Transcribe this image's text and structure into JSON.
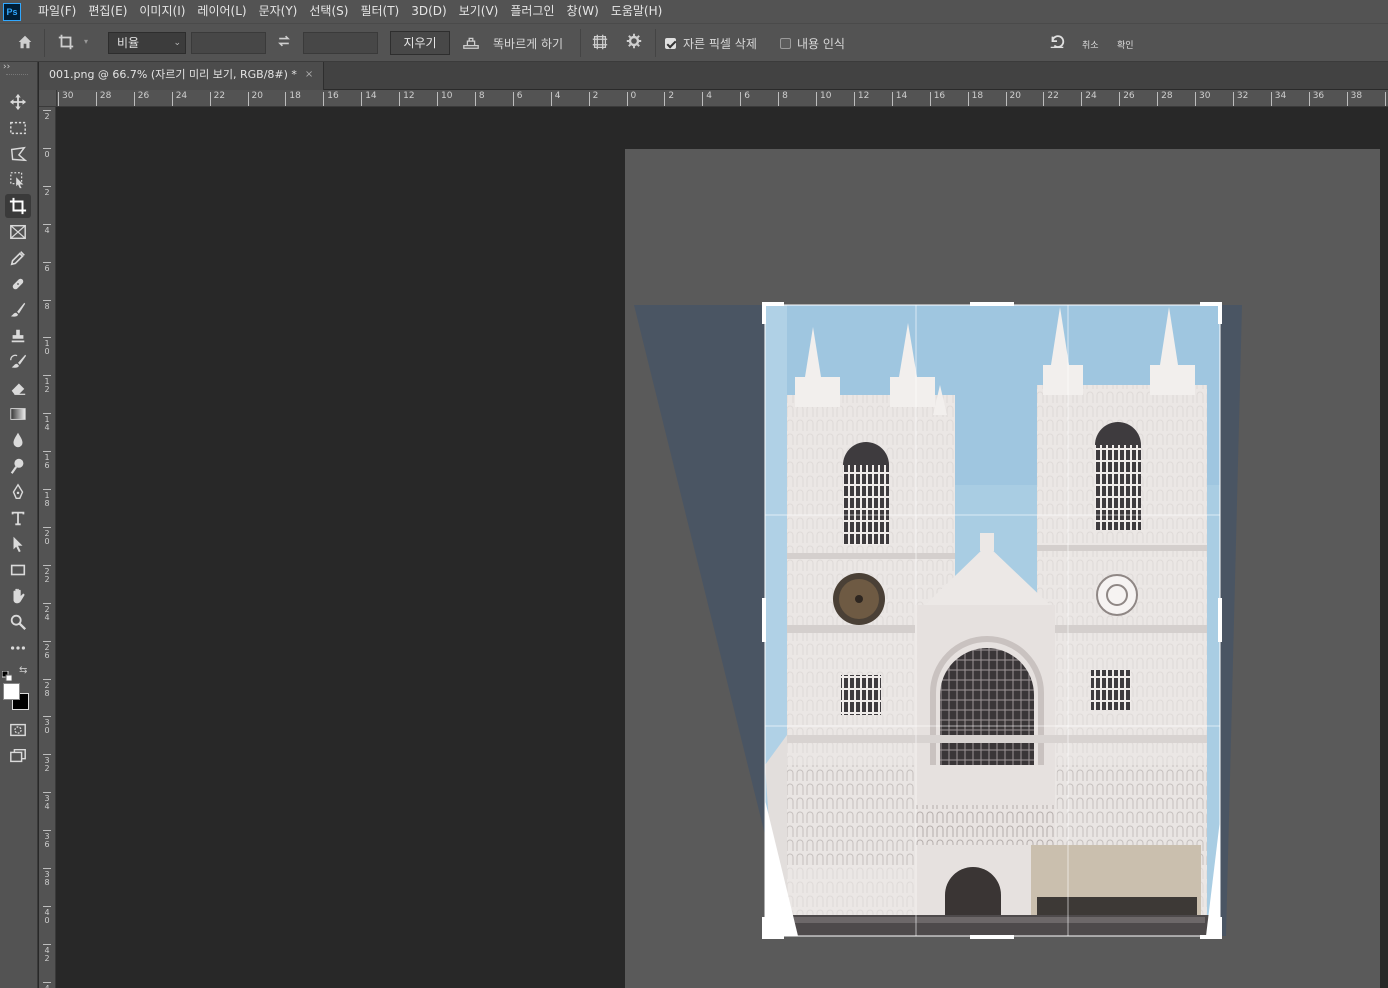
{
  "menubar": {
    "logo": "Ps",
    "items": [
      "파일(F)",
      "편집(E)",
      "이미지(I)",
      "레이어(L)",
      "문자(Y)",
      "선택(S)",
      "필터(T)",
      "3D(D)",
      "보기(V)",
      "플러그인",
      "창(W)",
      "도움말(H)"
    ]
  },
  "options": {
    "ratio_select": "비율",
    "width_value": "",
    "height_value": "",
    "clear_button": "지우기",
    "straighten_label": "똑바르게 하기",
    "delete_cropped_pixels_label": "자른 픽셀 삭제",
    "delete_cropped_pixels_checked": true,
    "content_aware_label": "내용 인식",
    "content_aware_checked": false,
    "cancel_label": "취소",
    "confirm_label": "확인"
  },
  "document": {
    "tab_title": "001.png @ 66.7% (자르기 미리 보기, RGB/8#) *",
    "close_symbol": "×"
  },
  "rulers": {
    "horizontal": [
      "30",
      "28",
      "26",
      "24",
      "22",
      "20",
      "18",
      "16",
      "14",
      "12",
      "10",
      "8",
      "6",
      "4",
      "2",
      "0",
      "2",
      "4",
      "6",
      "8",
      "10",
      "12",
      "14",
      "16",
      "18",
      "20",
      "22",
      "24",
      "26",
      "28",
      "30",
      "32",
      "34",
      "36",
      "38",
      "4"
    ],
    "vertical": [
      "2",
      "0",
      "2",
      "4",
      "6",
      "8",
      "10",
      "12",
      "14",
      "16",
      "18",
      "20",
      "22",
      "24",
      "26",
      "28",
      "30",
      "32",
      "34",
      "36",
      "38",
      "40",
      "42",
      "4"
    ]
  },
  "tools": [
    {
      "name": "move-tool",
      "icon": "move-icon"
    },
    {
      "name": "marquee-tool",
      "icon": "marquee-icon"
    },
    {
      "name": "lasso-tool",
      "icon": "lasso-icon"
    },
    {
      "name": "object-select-tool",
      "icon": "object-select-icon"
    },
    {
      "name": "crop-tool",
      "icon": "crop-icon",
      "active": true
    },
    {
      "name": "frame-tool",
      "icon": "frame-icon"
    },
    {
      "name": "eyedropper-tool",
      "icon": "eyedropper-icon"
    },
    {
      "name": "healing-brush-tool",
      "icon": "bandage-icon"
    },
    {
      "name": "brush-tool",
      "icon": "brush-icon"
    },
    {
      "name": "stamp-tool",
      "icon": "stamp-icon"
    },
    {
      "name": "history-brush-tool",
      "icon": "history-brush-icon"
    },
    {
      "name": "eraser-tool",
      "icon": "eraser-icon"
    },
    {
      "name": "gradient-tool",
      "icon": "gradient-icon"
    },
    {
      "name": "blur-tool",
      "icon": "drop-icon"
    },
    {
      "name": "dodge-tool",
      "icon": "dodge-icon"
    },
    {
      "name": "pen-tool",
      "icon": "pen-icon"
    },
    {
      "name": "type-tool",
      "icon": "type-icon"
    },
    {
      "name": "path-select-tool",
      "icon": "arrow-icon"
    },
    {
      "name": "rectangle-tool",
      "icon": "rectangle-icon"
    },
    {
      "name": "hand-tool",
      "icon": "hand-icon"
    },
    {
      "name": "zoom-tool",
      "icon": "zoom-icon"
    },
    {
      "name": "more-tools",
      "icon": "ellipsis-icon"
    }
  ],
  "colors": {
    "foreground": "#ffffff",
    "background": "#000000",
    "sky": "#a9cde3",
    "stone": "#ece8e6",
    "ui_panel": "#535353",
    "workspace": "#282828"
  }
}
